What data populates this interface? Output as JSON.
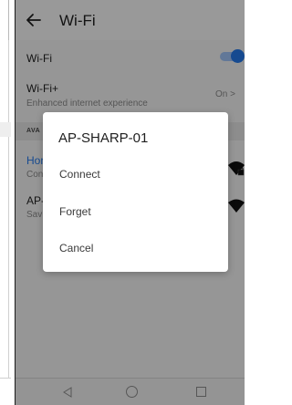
{
  "toolbar": {
    "title": "Wi-Fi"
  },
  "settings": {
    "wifi_label": "Wi-Fi",
    "wifi_enabled": true,
    "wifiplus_label": "Wi-Fi+",
    "wifiplus_desc": "Enhanced internet experience",
    "wifiplus_status": "On >"
  },
  "available": {
    "section_label": "AVA",
    "networks": [
      {
        "name": "Hor",
        "status": "Con"
      },
      {
        "name": "AP-",
        "status": "Sav"
      }
    ]
  },
  "dialog": {
    "title": "AP-SHARP-01",
    "options": [
      "Connect",
      "Forget",
      "Cancel"
    ]
  },
  "colors": {
    "accent": "#2478e8",
    "scrim": "rgba(0,0,0,0.38)"
  },
  "icons": [
    "back-arrow-icon",
    "wifi-lock-icon",
    "wifi-icon",
    "nav-back-icon",
    "nav-home-icon",
    "nav-recent-icon"
  ]
}
